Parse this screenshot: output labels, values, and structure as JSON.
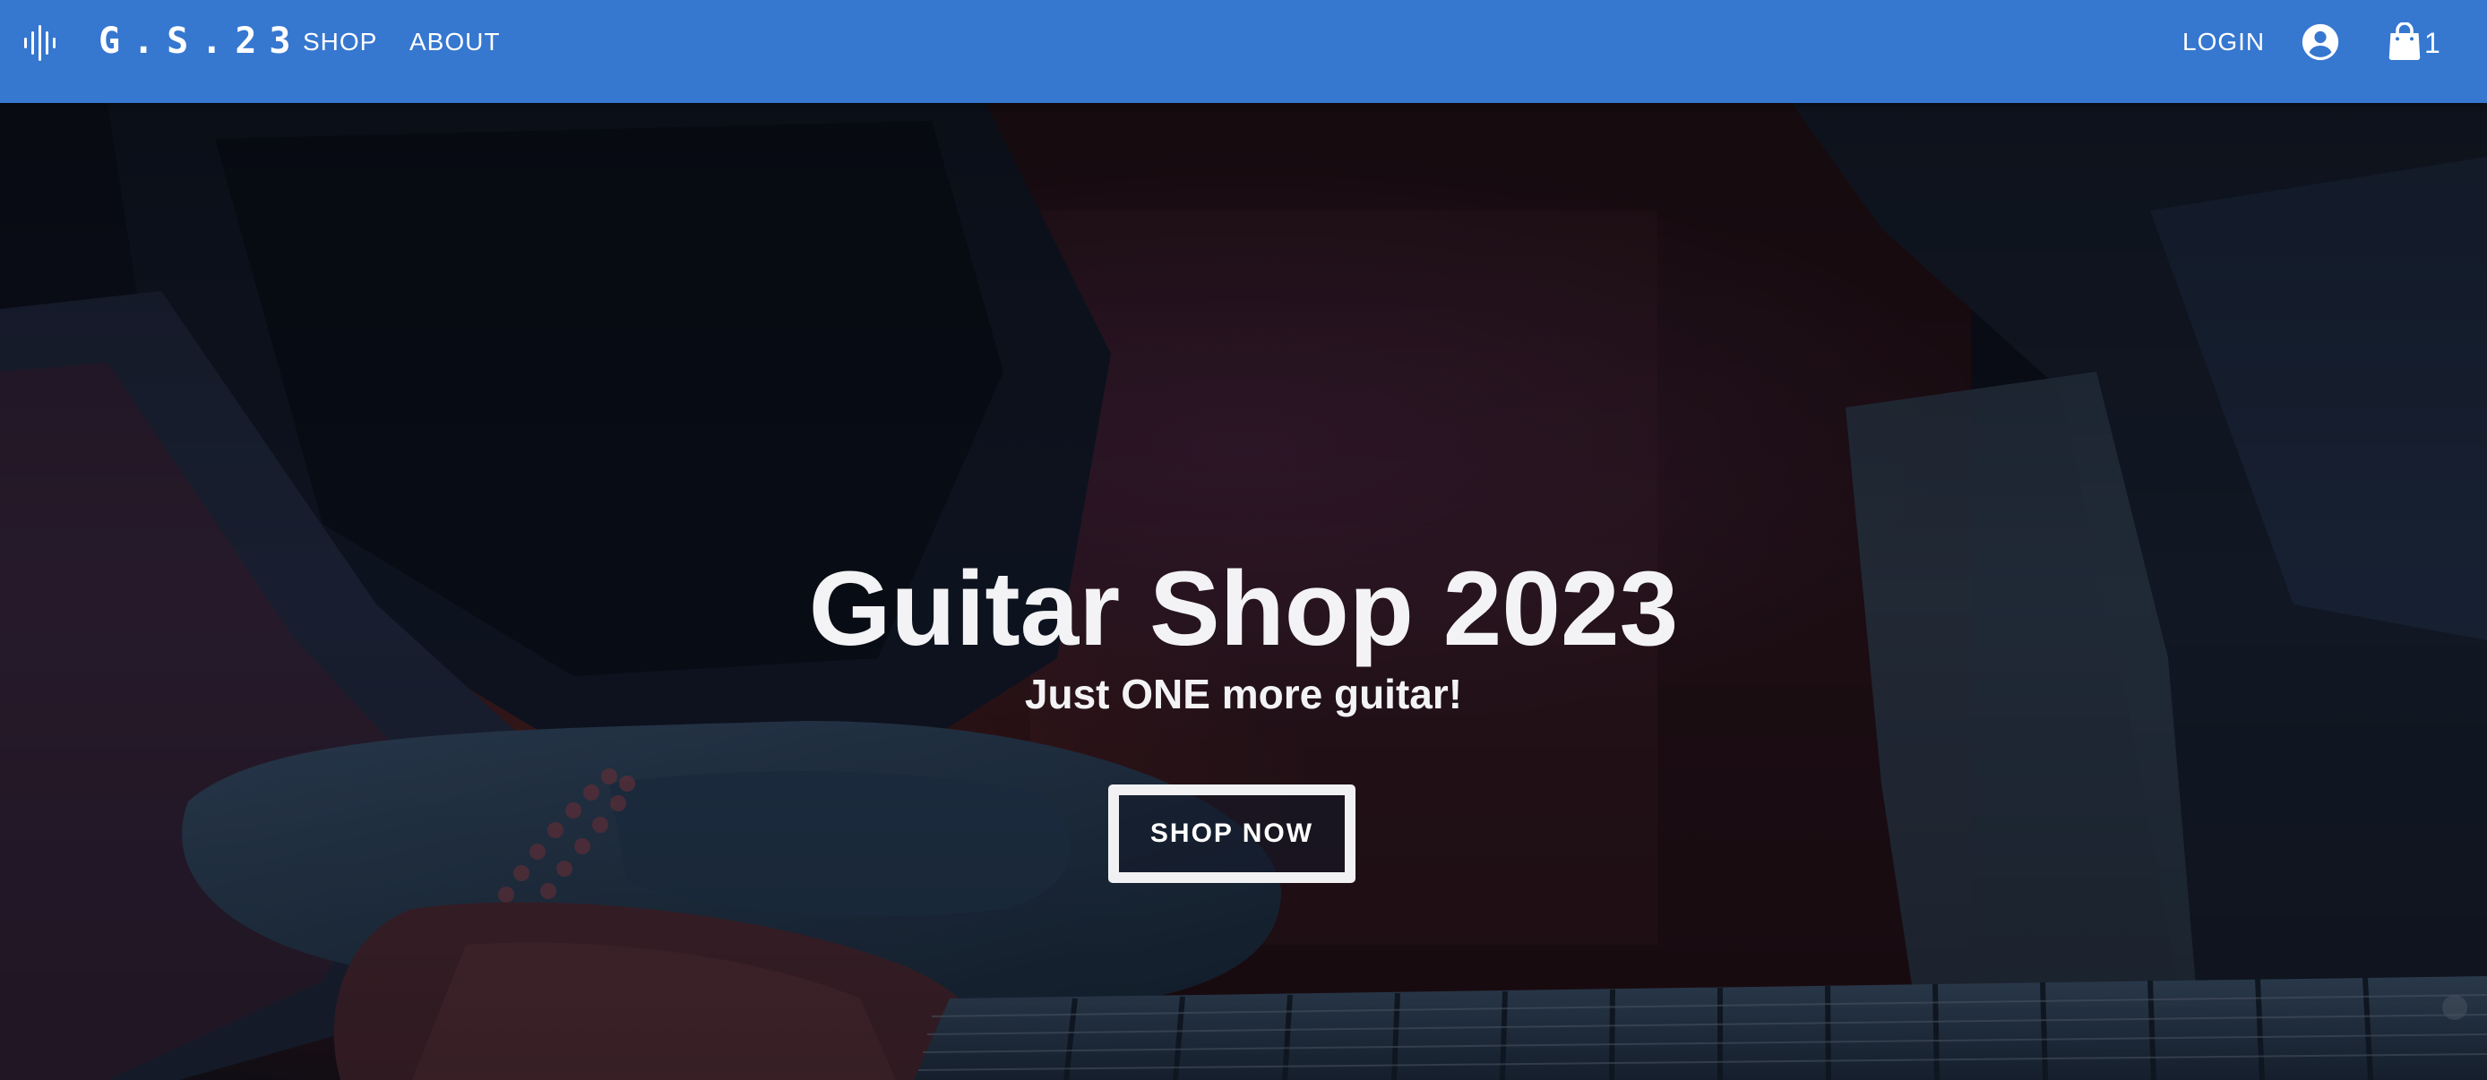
{
  "header": {
    "logo_icon": "waveform-icon",
    "brand": "G.S.23",
    "nav": {
      "shop_label": "SHOP",
      "about_label": "ABOUT",
      "login_label": "LOGIN"
    },
    "account_icon": "account-circle-icon",
    "cart_icon": "shopping-bag-icon",
    "cart_count": "1",
    "bar_color": "#3677d0"
  },
  "hero": {
    "title": "Guitar Shop 2023",
    "subtitle": "Just ONE more guitar!",
    "cta_label": "SHOP NOW",
    "background": "dark photo of a guitarist playing an electric guitar"
  }
}
